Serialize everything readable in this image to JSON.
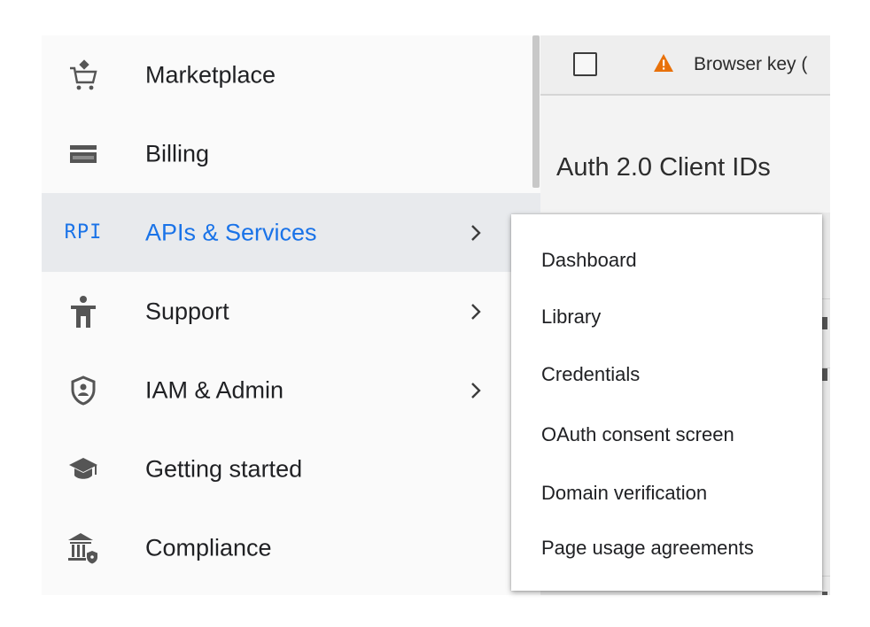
{
  "background_page": {
    "key_row_text": "Browser key (",
    "section_title": "Auth 2.0 Client IDs",
    "warning_color": "#e8710a"
  },
  "nav": {
    "items": [
      {
        "label": "Marketplace",
        "icon": "cart-icon",
        "has_submenu": false,
        "active": false
      },
      {
        "label": "Billing",
        "icon": "billing-card-icon",
        "has_submenu": false,
        "active": false
      },
      {
        "label": "APIs & Services",
        "icon_text": "RPI",
        "icon": "api-icon",
        "has_submenu": true,
        "active": true
      },
      {
        "label": "Support",
        "icon": "support-person-icon",
        "has_submenu": true,
        "active": false
      },
      {
        "label": "IAM & Admin",
        "icon": "shield-icon",
        "has_submenu": true,
        "active": false
      },
      {
        "label": "Getting started",
        "icon": "graduation-cap-icon",
        "has_submenu": false,
        "active": false
      },
      {
        "label": "Compliance",
        "icon": "compliance-building-icon",
        "has_submenu": false,
        "active": false
      }
    ],
    "chevron": ">",
    "active_color": "#1a73e8"
  },
  "submenu": {
    "items": [
      {
        "label": "Dashboard"
      },
      {
        "label": "Library"
      },
      {
        "label": "Credentials"
      },
      {
        "label": "OAuth consent screen"
      },
      {
        "label": "Domain verification"
      },
      {
        "label": "Page usage agreements"
      }
    ]
  }
}
